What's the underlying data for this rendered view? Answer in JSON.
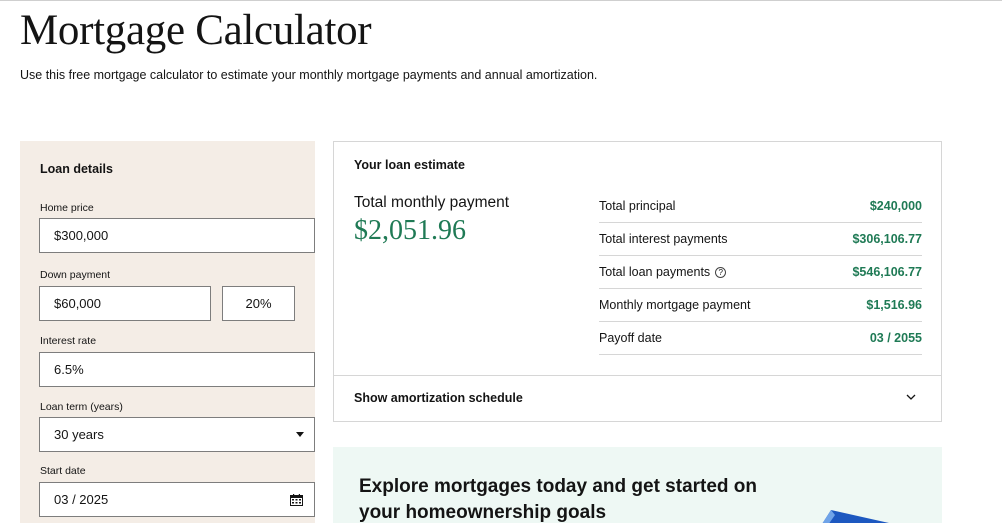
{
  "page": {
    "title": "Mortgage Calculator",
    "subtitle": "Use this free mortgage calculator to estimate your monthly mortgage payments and annual amortization."
  },
  "loan_details": {
    "heading": "Loan details",
    "home_price_label": "Home price",
    "home_price": "$300,000",
    "down_payment_label": "Down payment",
    "down_payment": "$60,000",
    "down_payment_percent": "20%",
    "interest_rate_label": "Interest rate",
    "interest_rate": "6.5%",
    "loan_term_label": "Loan term (years)",
    "loan_term": "30 years",
    "start_date_label": "Start date",
    "start_date": "03 / 2025"
  },
  "estimate": {
    "heading": "Your loan estimate",
    "total_monthly_label": "Total monthly payment",
    "total_monthly_value": "$2,051.96",
    "rows": [
      {
        "label": "Total principal",
        "value": "$240,000"
      },
      {
        "label": "Total interest payments",
        "value": "$306,106.77"
      },
      {
        "label": "Total loan payments",
        "value": "$546,106.77"
      },
      {
        "label": "Monthly mortgage payment",
        "value": "$1,516.96"
      },
      {
        "label": "Payoff date",
        "value": "03 / 2055"
      }
    ],
    "amortization_label": "Show amortization schedule"
  },
  "promo": {
    "text": "Explore mortgages today and get started on your homeownership goals"
  },
  "colors": {
    "accent_green": "#1f7a55",
    "panel_bg": "#f4ede6",
    "promo_bg": "#eef8f4"
  },
  "icons": [
    "help-icon",
    "chevron-down-icon",
    "calendar-icon",
    "dropdown-caret-icon"
  ]
}
